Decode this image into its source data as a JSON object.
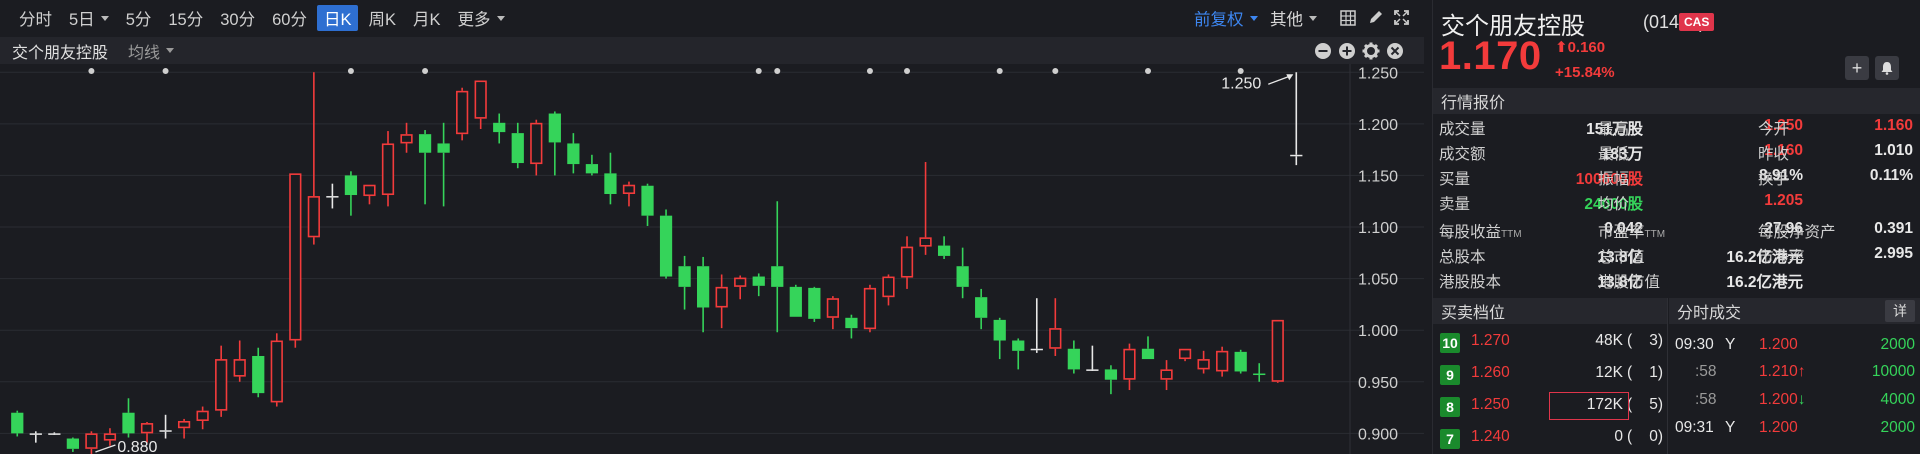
{
  "toolbar": {
    "timeframes": [
      "分时",
      "5日",
      "5分",
      "15分",
      "30分",
      "60分",
      "日K",
      "周K",
      "月K",
      "更多"
    ],
    "active": "日K",
    "adjust": "前复权",
    "other": "其他"
  },
  "subbar": {
    "stock_name": "交个朋友控股",
    "indicator": "均线"
  },
  "chart_data": {
    "type": "candlestick",
    "y_ticks": [
      "1.250",
      "1.200",
      "1.150",
      "1.100",
      "1.050",
      "1.000",
      "0.950",
      "0.900"
    ],
    "ylim": [
      0.88,
      1.258
    ],
    "max_label": "1.250",
    "min_label": "0.880",
    "colors": {
      "up": "#f33b3b",
      "down": "#35d45a",
      "flat": "#e8e8e8",
      "grid": "#2b2c33",
      "bg": "#1b1c21"
    },
    "candles": [
      {
        "o": 0.92,
        "h": 0.922,
        "l": 0.897,
        "c": 0.9
      },
      {
        "o": 0.9,
        "h": 0.902,
        "l": 0.891,
        "c": 0.9
      },
      {
        "o": 0.9,
        "h": 0.901,
        "l": 0.899,
        "c": 0.9
      },
      {
        "o": 0.895,
        "h": 0.896,
        "l": 0.882,
        "c": 0.885
      },
      {
        "o": 0.885,
        "h": 0.902,
        "l": 0.88,
        "c": 0.9
      },
      {
        "o": 0.893,
        "h": 0.905,
        "l": 0.888,
        "c": 0.9
      },
      {
        "o": 0.92,
        "h": 0.934,
        "l": 0.896,
        "c": 0.9
      },
      {
        "o": 0.9,
        "h": 0.911,
        "l": 0.891,
        "c": 0.91
      },
      {
        "o": 0.903,
        "h": 0.918,
        "l": 0.895,
        "c": 0.903
      },
      {
        "o": 0.905,
        "h": 0.914,
        "l": 0.895,
        "c": 0.912
      },
      {
        "o": 0.912,
        "h": 0.926,
        "l": 0.904,
        "c": 0.922
      },
      {
        "o": 0.922,
        "h": 0.985,
        "l": 0.916,
        "c": 0.972
      },
      {
        "o": 0.955,
        "h": 0.99,
        "l": 0.95,
        "c": 0.972
      },
      {
        "o": 0.975,
        "h": 0.983,
        "l": 0.935,
        "c": 0.939
      },
      {
        "o": 0.93,
        "h": 0.997,
        "l": 0.926,
        "c": 0.99
      },
      {
        "o": 0.99,
        "h": 1.152,
        "l": 0.983,
        "c": 1.152
      },
      {
        "o": 1.09,
        "h": 1.25,
        "l": 1.083,
        "c": 1.13
      },
      {
        "o": 1.13,
        "h": 1.142,
        "l": 1.118,
        "c": 1.13
      },
      {
        "o": 1.15,
        "h": 1.154,
        "l": 1.111,
        "c": 1.131
      },
      {
        "o": 1.13,
        "h": 1.141,
        "l": 1.122,
        "c": 1.141
      },
      {
        "o": 1.131,
        "h": 1.193,
        "l": 1.12,
        "c": 1.181
      },
      {
        "o": 1.181,
        "h": 1.201,
        "l": 1.172,
        "c": 1.19
      },
      {
        "o": 1.19,
        "h": 1.194,
        "l": 1.122,
        "c": 1.172
      },
      {
        "o": 1.181,
        "h": 1.201,
        "l": 1.12,
        "c": 1.172
      },
      {
        "o": 1.19,
        "h": 1.235,
        "l": 1.184,
        "c": 1.232
      },
      {
        "o": 1.205,
        "h": 1.242,
        "l": 1.195,
        "c": 1.242
      },
      {
        "o": 1.201,
        "h": 1.21,
        "l": 1.181,
        "c": 1.192
      },
      {
        "o": 1.191,
        "h": 1.201,
        "l": 1.157,
        "c": 1.162
      },
      {
        "o": 1.161,
        "h": 1.204,
        "l": 1.15,
        "c": 1.201
      },
      {
        "o": 1.21,
        "h": 1.212,
        "l": 1.15,
        "c": 1.182
      },
      {
        "o": 1.181,
        "h": 1.191,
        "l": 1.152,
        "c": 1.161
      },
      {
        "o": 1.161,
        "h": 1.17,
        "l": 1.15,
        "c": 1.152
      },
      {
        "o": 1.152,
        "h": 1.172,
        "l": 1.122,
        "c": 1.132
      },
      {
        "o": 1.132,
        "h": 1.144,
        "l": 1.12,
        "c": 1.141
      },
      {
        "o": 1.14,
        "h": 1.142,
        "l": 1.101,
        "c": 1.111
      },
      {
        "o": 1.111,
        "h": 1.117,
        "l": 1.05,
        "c": 1.052
      },
      {
        "o": 1.062,
        "h": 1.072,
        "l": 1.02,
        "c": 1.042
      },
      {
        "o": 1.062,
        "h": 1.071,
        "l": 0.998,
        "c": 1.022
      },
      {
        "o": 1.022,
        "h": 1.054,
        "l": 1.002,
        "c": 1.042
      },
      {
        "o": 1.042,
        "h": 1.053,
        "l": 1.03,
        "c": 1.051
      },
      {
        "o": 1.052,
        "h": 1.055,
        "l": 1.033,
        "c": 1.043
      },
      {
        "o": 1.062,
        "h": 1.125,
        "l": 0.998,
        "c": 1.042
      },
      {
        "o": 1.042,
        "h": 1.044,
        "l": 1.013,
        "c": 1.013
      },
      {
        "o": 1.041,
        "h": 1.042,
        "l": 1.008,
        "c": 1.011
      },
      {
        "o": 1.012,
        "h": 1.033,
        "l": 1.001,
        "c": 1.031
      },
      {
        "o": 1.012,
        "h": 1.015,
        "l": 0.992,
        "c": 1.002
      },
      {
        "o": 1.001,
        "h": 1.044,
        "l": 0.998,
        "c": 1.041
      },
      {
        "o": 1.032,
        "h": 1.054,
        "l": 1.024,
        "c": 1.052
      },
      {
        "o": 1.051,
        "h": 1.091,
        "l": 1.04,
        "c": 1.081
      },
      {
        "o": 1.081,
        "h": 1.163,
        "l": 1.073,
        "c": 1.09
      },
      {
        "o": 1.082,
        "h": 1.091,
        "l": 1.069,
        "c": 1.072
      },
      {
        "o": 1.062,
        "h": 1.08,
        "l": 1.031,
        "c": 1.042
      },
      {
        "o": 1.032,
        "h": 1.04,
        "l": 1.001,
        "c": 1.012
      },
      {
        "o": 1.01,
        "h": 1.012,
        "l": 0.972,
        "c": 0.99
      },
      {
        "o": 0.99,
        "h": 0.992,
        "l": 0.962,
        "c": 0.98
      },
      {
        "o": 0.982,
        "h": 1.031,
        "l": 0.978,
        "c": 0.982
      },
      {
        "o": 0.982,
        "h": 1.031,
        "l": 0.975,
        "c": 1.002
      },
      {
        "o": 0.982,
        "h": 0.99,
        "l": 0.958,
        "c": 0.962
      },
      {
        "o": 0.962,
        "h": 0.985,
        "l": 0.962,
        "c": 0.962
      },
      {
        "o": 0.962,
        "h": 0.966,
        "l": 0.938,
        "c": 0.952
      },
      {
        "o": 0.952,
        "h": 0.987,
        "l": 0.942,
        "c": 0.982
      },
      {
        "o": 0.982,
        "h": 0.994,
        "l": 0.972,
        "c": 0.972
      },
      {
        "o": 0.952,
        "h": 0.971,
        "l": 0.942,
        "c": 0.962
      },
      {
        "o": 0.972,
        "h": 0.982,
        "l": 0.97,
        "c": 0.982
      },
      {
        "o": 0.962,
        "h": 0.98,
        "l": 0.958,
        "c": 0.972
      },
      {
        "o": 0.96,
        "h": 0.984,
        "l": 0.955,
        "c": 0.98
      },
      {
        "o": 0.979,
        "h": 0.981,
        "l": 0.958,
        "c": 0.96
      },
      {
        "o": 0.958,
        "h": 0.968,
        "l": 0.95,
        "c": 0.957
      },
      {
        "o": 0.95,
        "h": 1.01,
        "l": 0.949,
        "c": 1.01
      },
      {
        "o": 1.17,
        "h": 1.25,
        "l": 1.16,
        "c": 1.17
      }
    ]
  },
  "quote": {
    "name": "交个朋友控股",
    "code": "(01450)",
    "badge": "CAS",
    "price": "1.170",
    "change": "0.160",
    "change_pct": "+15.84%",
    "arrow_up": "⬆"
  },
  "sections": {
    "market": "行情报价",
    "depth": "买卖档位",
    "trades": "分时成交",
    "detail": "详"
  },
  "stats": [
    {
      "label": "成交量",
      "value": "151万股",
      "label2": "最高",
      "value2": "1.250",
      "label3": "今开",
      "value3": "1.160"
    },
    {
      "label": "成交额",
      "value": "183万",
      "label2": "最低",
      "value2": "1.160",
      "label3": "昨收",
      "value3": "1.010"
    },
    {
      "label": "买量",
      "value": "100000股",
      "label2": "振幅",
      "value2": "8.91%",
      "label3": "换手",
      "value3": "0.11%"
    },
    {
      "label": "卖量",
      "value": "24000股",
      "label2": "均价",
      "value2": "1.205"
    }
  ],
  "fundamentals": [
    {
      "label": "每股收益",
      "sub": "TTM",
      "value": "0.042",
      "label2": "市盈率",
      "sub2": "TTM",
      "value2": "27.96",
      "label3": "每股净资产",
      "value3": "0.391"
    },
    {
      "label": "总股本",
      "value": "13.8亿",
      "label2": "总市值",
      "value2": "16.2亿港元",
      "label3": "市净率",
      "value3": "2.995"
    },
    {
      "label": "港股股本",
      "value": "13.8亿",
      "label2": "港股市值",
      "value2": "16.2亿港元"
    }
  ],
  "depth": [
    {
      "level": "10",
      "price": "1.270",
      "vol": "48K",
      "count": "3"
    },
    {
      "level": "9",
      "price": "1.260",
      "vol": "12K",
      "count": "1"
    },
    {
      "level": "8",
      "price": "1.250",
      "vol": "172K",
      "count": "5"
    },
    {
      "level": "7",
      "price": "1.240",
      "vol": "0",
      "count": "0"
    }
  ],
  "trades": [
    {
      "time": "09:30",
      "flag": "Y",
      "price": "1.200",
      "arrow": "",
      "vol": "2000"
    },
    {
      "time": ":58",
      "flag": "",
      "price": "1.210",
      "arrow": "↑",
      "vol": "10000"
    },
    {
      "time": ":58",
      "flag": "",
      "price": "1.200",
      "arrow": "↓",
      "vol": "4000"
    },
    {
      "time": "09:31",
      "flag": "Y",
      "price": "1.200",
      "arrow": "",
      "vol": "2000"
    }
  ]
}
